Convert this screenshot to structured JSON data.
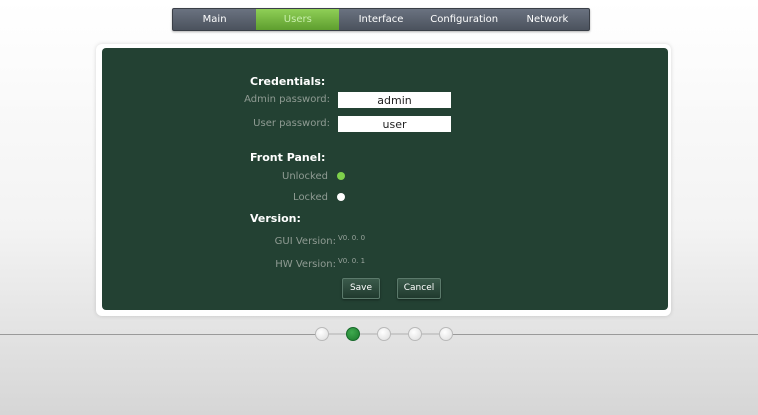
{
  "nav": {
    "tabs": [
      {
        "label": "Main"
      },
      {
        "label": "Users"
      },
      {
        "label": "Interface"
      },
      {
        "label": "Configuration"
      },
      {
        "label": "Network"
      }
    ],
    "active_tab": "Users"
  },
  "credentials": {
    "title": "Credentials:",
    "admin_label": "Admin password:",
    "admin_value": "admin",
    "user_label": "User password:",
    "user_value": "user"
  },
  "front_panel": {
    "title": "Front Panel:",
    "unlocked_label": "Unlocked",
    "locked_label": "Locked",
    "selected": "Unlocked"
  },
  "version": {
    "title": "Version:",
    "gui_label": "GUI  Version:",
    "gui_value": "V0. 0. 0",
    "hw_label": "HW  Version:",
    "hw_value": "V0. 0. 1"
  },
  "buttons": {
    "save": "Save",
    "cancel": "Cancel"
  },
  "pager": {
    "pages": 5,
    "active_index": 2
  },
  "colors": {
    "panel": "#234133",
    "accent_green": "#8fcf57",
    "selected_dot": "#7ed04b",
    "unselected_dot": "#ffffff"
  }
}
